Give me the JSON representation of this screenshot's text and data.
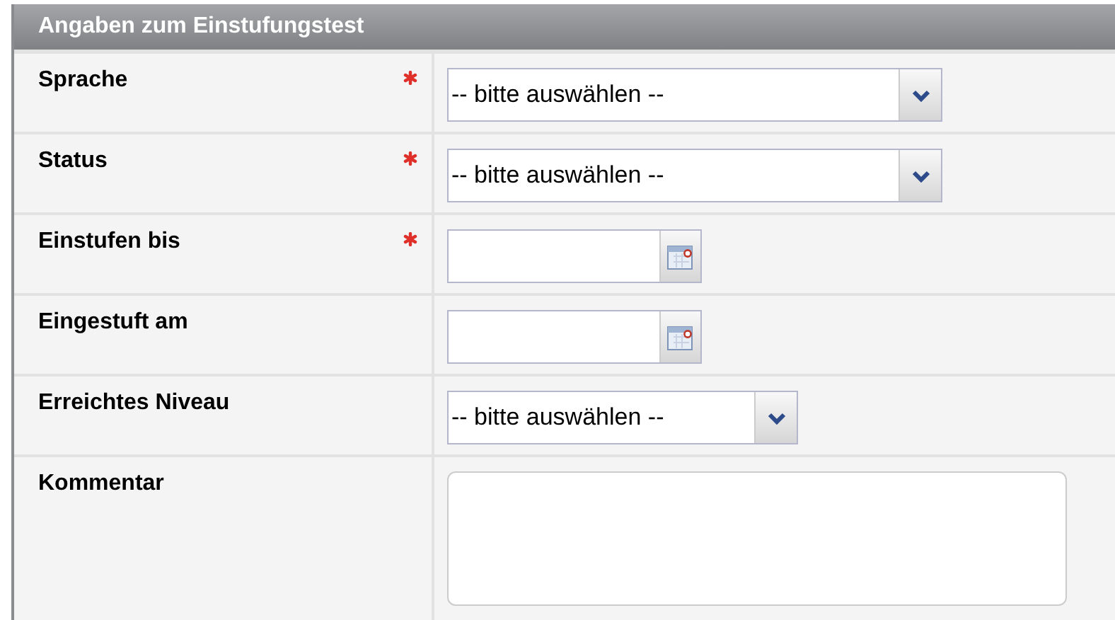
{
  "panel": {
    "title": "Angaben zum Einstufungstest"
  },
  "rows": [
    {
      "label": "Sprache",
      "required": true,
      "kind": "select",
      "value": "-- bitte auswählen --"
    },
    {
      "label": "Status",
      "required": true,
      "kind": "select",
      "value": "-- bitte auswählen --"
    },
    {
      "label": "Einstufen bis",
      "required": true,
      "kind": "date"
    },
    {
      "label": "Eingestuft am",
      "required": false,
      "kind": "date"
    },
    {
      "label": "Erreichtes Niveau",
      "required": false,
      "kind": "select-short",
      "value": "-- bitte auswählen --"
    },
    {
      "label": "Kommentar",
      "required": false,
      "kind": "textarea"
    }
  ]
}
